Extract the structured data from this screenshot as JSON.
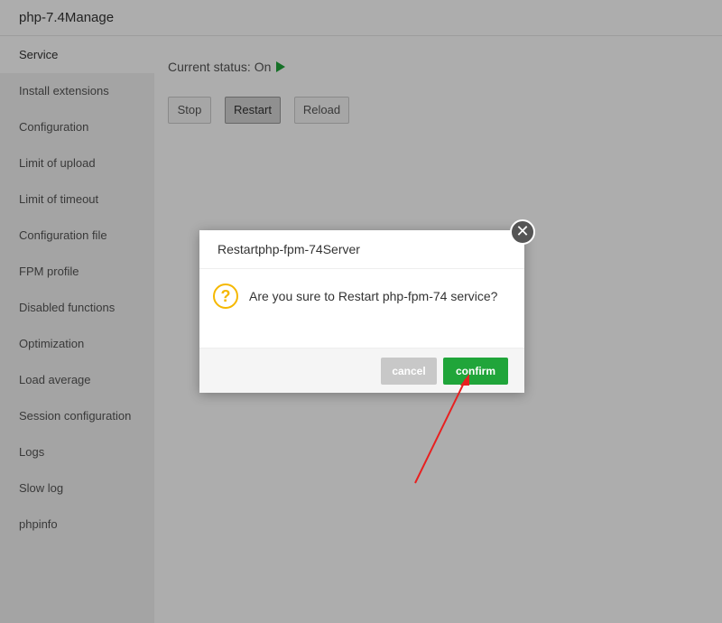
{
  "window": {
    "title": "php-7.4Manage"
  },
  "sidebar": {
    "items": [
      {
        "label": "Service"
      },
      {
        "label": "Install extensions"
      },
      {
        "label": "Configuration"
      },
      {
        "label": "Limit of upload"
      },
      {
        "label": "Limit of timeout"
      },
      {
        "label": "Configuration file"
      },
      {
        "label": "FPM profile"
      },
      {
        "label": "Disabled functions"
      },
      {
        "label": "Optimization"
      },
      {
        "label": "Load average"
      },
      {
        "label": "Session configuration"
      },
      {
        "label": "Logs"
      },
      {
        "label": "Slow log"
      },
      {
        "label": "phpinfo"
      }
    ],
    "active_index": 0
  },
  "service": {
    "status_label": "Current status:",
    "status_value": "On",
    "buttons": {
      "stop": "Stop",
      "restart": "Restart",
      "reload": "Reload"
    }
  },
  "dialog": {
    "title": "Restartphp-fpm-74Server",
    "message": "Are you sure to Restart php-fpm-74 service?",
    "icon": "question-icon",
    "cancel_label": "cancel",
    "confirm_label": "confirm",
    "close_icon": "close-icon"
  },
  "colors": {
    "accent_green": "#20a53a",
    "warning_yellow": "#f5b800",
    "annotation_red": "#e82020"
  }
}
